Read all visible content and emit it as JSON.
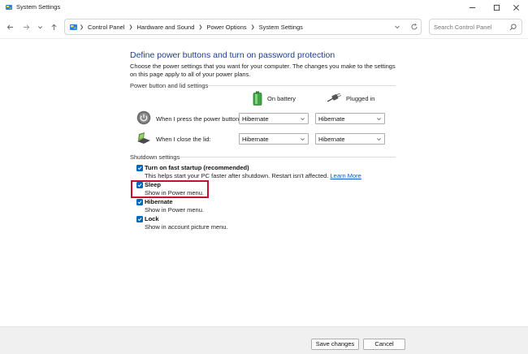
{
  "window": {
    "title": "System Settings",
    "controls": {
      "minimize": "minimize-icon",
      "maximize": "maximize-icon",
      "close": "close-icon"
    }
  },
  "address_bar": {
    "breadcrumb": [
      "Control Panel",
      "Hardware and Sound",
      "Power Options",
      "System Settings"
    ],
    "search_placeholder": "Search Control Panel"
  },
  "page": {
    "heading": "Define power buttons and turn on password protection",
    "intro": "Choose the power settings that you want for your computer. The changes you make to the settings on this page apply to all of your power plans.",
    "power_group": {
      "label": "Power button and lid settings",
      "columns": {
        "battery": "On battery",
        "plugged": "Plugged in"
      },
      "rows": [
        {
          "label": "When I press the power button:",
          "battery": "Hibernate",
          "plugged": "Hibernate"
        },
        {
          "label": "When I close the lid:",
          "battery": "Hibernate",
          "plugged": "Hibernate"
        }
      ]
    },
    "shutdown_group": {
      "label": "Shutdown settings",
      "options": [
        {
          "label": "Turn on fast startup (recommended)",
          "desc": "This helps start your PC faster after shutdown. Restart isn't affected.",
          "link": "Learn More",
          "checked": true
        },
        {
          "label": "Sleep",
          "desc": "Show in Power menu.",
          "checked": true
        },
        {
          "label": "Hibernate",
          "desc": "Show in Power menu.",
          "checked": true
        },
        {
          "label": "Lock",
          "desc": "Show in account picture menu.",
          "checked": true
        }
      ]
    }
  },
  "footer": {
    "save": "Save changes",
    "cancel": "Cancel"
  },
  "colors": {
    "heading": "#1e3f8a",
    "checkbox": "#0067c0",
    "highlight": "#c8102e",
    "link": "#0a58ca"
  }
}
